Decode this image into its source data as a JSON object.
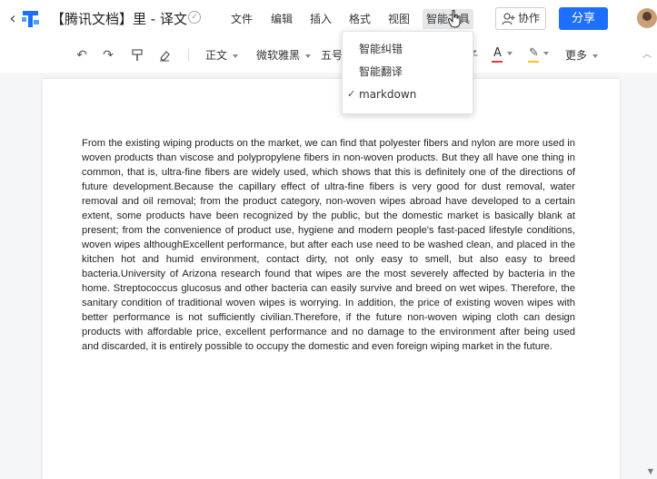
{
  "app": {
    "doc_title": "【腾讯文档】里 - 译文",
    "back_glyph": "‹",
    "title_status_glyph": "✓"
  },
  "menus": [
    "文件",
    "编辑",
    "插入",
    "格式",
    "视图",
    "智能工具"
  ],
  "collab_label": "协作",
  "share_label": "分享",
  "toolbar": {
    "style_label": "正文",
    "font_label": "微软雅黑",
    "size_label": "五号",
    "more_label": "更多",
    "text_color_glyph": "A",
    "highlight_glyph": "✎",
    "undo_glyph": "↶",
    "redo_glyph": "↷",
    "collapse_glyph": "︿",
    "text_color": "#e53935",
    "highlight_color": "#f5c518",
    "hidden_glyph": "子"
  },
  "dropdown": {
    "items": [
      {
        "label": "智能纠错",
        "checked": false
      },
      {
        "label": "智能翻译",
        "checked": false
      },
      {
        "label": "markdown",
        "checked": true
      }
    ],
    "check_glyph": "✓"
  },
  "document": {
    "paragraph": "From the existing wiping products on the market, we can find that polyester fibers and nylon are more used in woven products than viscose and polypropylene fibers in non-woven products. But they all have one thing in common, that is, ultra-fine fibers are widely used, which shows that this is definitely one of the directions of future development.Because the capillary effect of ultra-fine fibers is very good for dust removal, water removal and oil removal; from the product category, non-woven wipes abroad have developed to a certain extent, some products have been recognized by the public, but the domestic market is basically blank at present; from the convenience of product use, hygiene and modern people's fast-paced lifestyle conditions, woven wipes althoughExcellent performance, but after each use need to be washed clean, and placed in the kitchen hot and humid environment, contact dirty, not only easy to smell, but also easy to breed bacteria.University of Arizona research found that wipes are the most severely affected by bacteria in the home. Streptococcus glucosus and other bacteria can easily survive and breed on wet wipes. Therefore, the sanitary condition of traditional woven wipes is worrying. In addition, the price of existing woven wipes with better performance is not sufficiently civilian.Therefore, if the future non-woven wiping cloth can design products with affordable price, excellent performance and no damage to the environment after being used and discarded, it is entirely possible to occupy the domestic and even foreign wiping market in the future."
  },
  "colors": {
    "brand_blue": "#1e6fff",
    "active_menu_bg": "#e6e7e9"
  }
}
